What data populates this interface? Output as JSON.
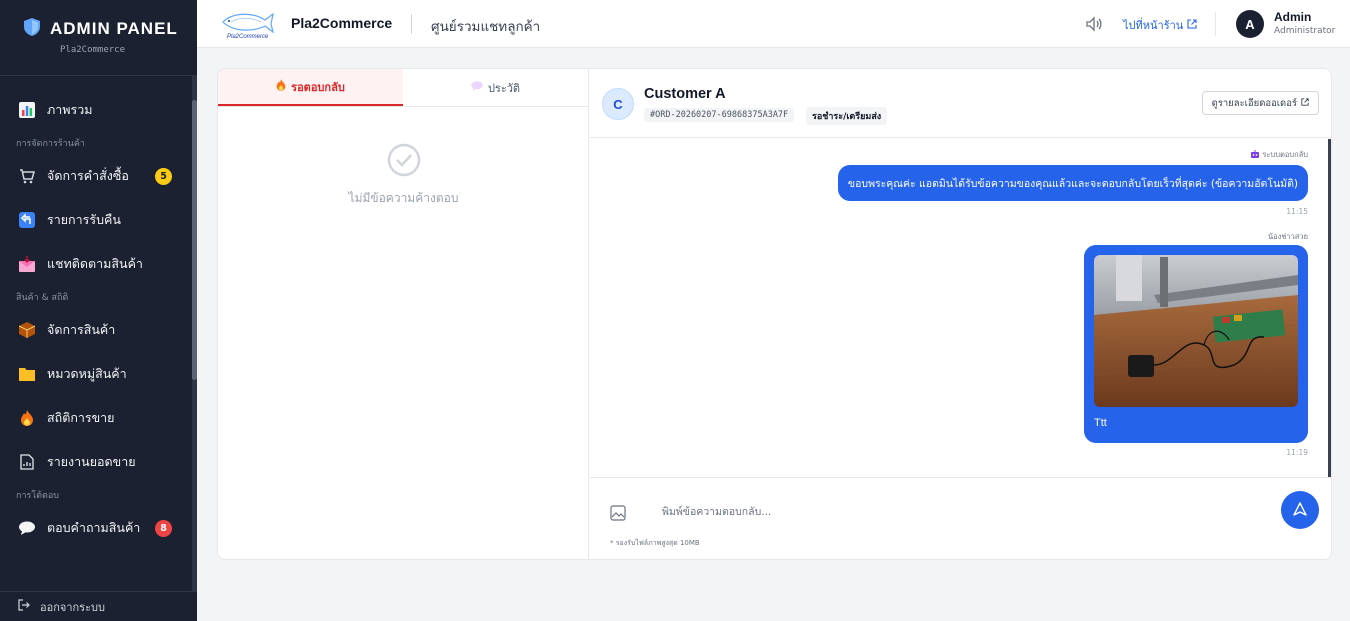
{
  "sidebar": {
    "title": "ADMIN PANEL",
    "subtitle": "Pla2Commerce",
    "items": {
      "overview": "ภาพรวม",
      "orders": "จัดการคำสั่งซื้อ",
      "returns": "รายการรับคืน",
      "product_chat": "แชทติดตามสินค้า",
      "products": "จัดการสินค้า",
      "categories": "หมวดหมู่สินค้า",
      "sales_stats": "สถิติการขาย",
      "sales_report": "รายงานยอดขาย",
      "product_qa": "ตอบคำถามสินค้า"
    },
    "sections": {
      "store": "การจัดการร้านค้า",
      "product_stats": "สินค้า & สถิติ",
      "interaction": "การโต้ตอบ"
    },
    "badges": {
      "orders": "5",
      "product_qa": "8"
    },
    "logout": "ออกจากระบบ"
  },
  "topbar": {
    "logo_text": "Pla2Commerce",
    "store_name": "Pla2Commerce",
    "page_title": "ศูนย์รวมแชทลูกค้า",
    "shop_link": "ไปที่หน้าร้าน",
    "user_initial": "A",
    "user_name": "Admin",
    "user_role": "Administrator"
  },
  "left_pane": {
    "tabs": {
      "pending": "รอตอบกลับ",
      "history": "ประวัติ"
    },
    "empty_text": "ไม่มีข้อความค้างตอบ"
  },
  "chat": {
    "customer_initial": "C",
    "customer_name": "Customer A",
    "order_id": "#ORD-20260207-69868375A3A7F",
    "order_status": "รอชำระ/เตรียมส่ง",
    "detail_button": "ดูรายละเอียดออเดอร์",
    "messages": {
      "m1": {
        "sender": "ระบบตอบกลับ",
        "text": "ขอบพระคุณค่ะ แอดมินได้รับข้อความของคุณแล้วและจะตอบกลับโดยเร็วที่สุดค่ะ (ข้อความอัตโนมัติ)",
        "time": "11:15"
      },
      "m2": {
        "sender": "น้องช่าวสวย",
        "caption": "Ttt",
        "time": "11:19"
      }
    },
    "input_placeholder": "พิมพ์ข้อความตอบกลับ...",
    "hint": "* รองรับไฟล์ภาพสูงสุด 10MB"
  },
  "colors": {
    "sidebar_bg": "#1b2130",
    "accent": "#2563eb",
    "danger": "#dc2626",
    "badge_yellow": "#facc15"
  }
}
